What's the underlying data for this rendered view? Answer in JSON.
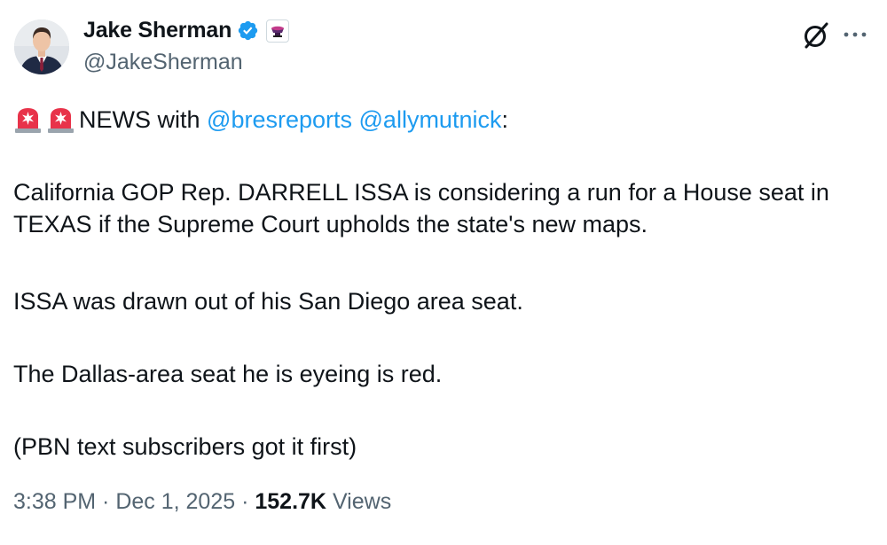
{
  "author": {
    "display_name": "Jake Sherman",
    "handle": "@JakeSherman",
    "verified_color": "#1d9bf0"
  },
  "tweet": {
    "line1_prefix": "NEWS with ",
    "mention1": "@bresreports",
    "mention2": "@allymutnick",
    "line1_suffix": ":",
    "paragraph2": "California GOP Rep. DARRELL ISSA is considering a run for a House seat in TEXAS if the Supreme Court upholds the state's new maps.",
    "paragraph3": "ISSA was drawn out of his San Diego area seat.",
    "paragraph4": "The Dallas-area seat he is eyeing is red.",
    "paragraph5": "(PBN text subscribers got it first)"
  },
  "meta": {
    "time": "3:38 PM",
    "separator": " · ",
    "date": "Dec 1, 2025",
    "views_count": "152.7K",
    "views_label": "Views"
  },
  "colors": {
    "mention": "#1d9bf0",
    "secondary_text": "#536471",
    "siren_red": "#e8334a"
  },
  "icons": [
    "verified-icon",
    "affiliation-badge-icon",
    "siren-icon",
    "grok-icon",
    "more-icon"
  ]
}
